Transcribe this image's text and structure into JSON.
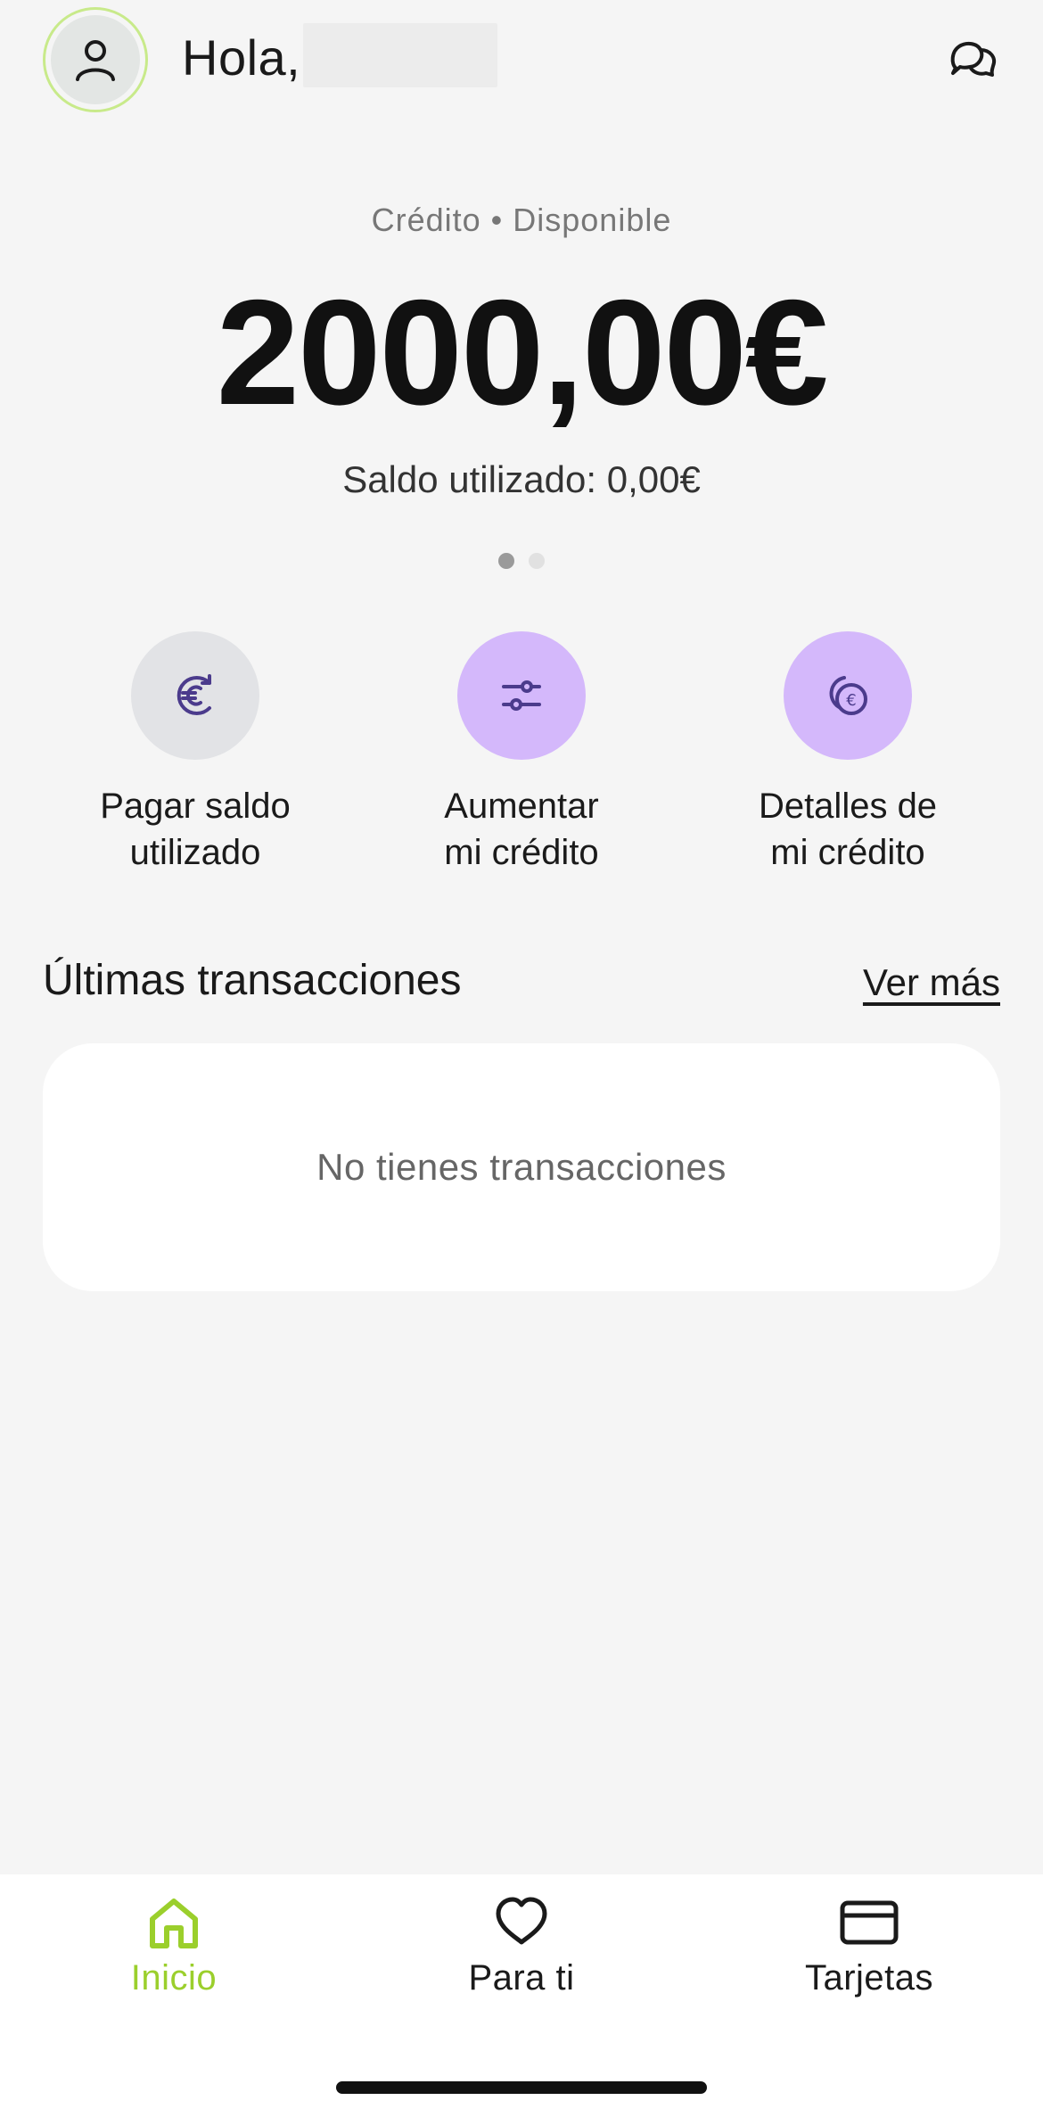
{
  "header": {
    "greeting": "Hola,",
    "avatar_icon": "user-icon",
    "chat_icon": "chat-bubbles-icon"
  },
  "balance": {
    "label": "Crédito • Disponible",
    "amount": "2000,00€",
    "used": "Saldo utilizado: 0,00€",
    "pages": 2,
    "active_page": 1
  },
  "actions": [
    {
      "label": "Pagar saldo\nutilizado",
      "icon": "euro-refresh-icon",
      "bg": "#e2e3e6"
    },
    {
      "label": "Aumentar\nmi crédito",
      "icon": "sliders-icon",
      "bg": "#d4b8fb"
    },
    {
      "label": "Detalles de\nmi crédito",
      "icon": "coins-euro-icon",
      "bg": "#d4b8fb"
    }
  ],
  "transactions": {
    "title": "Últimas transacciones",
    "more_label": "Ver más",
    "empty_text": "No tienes transacciones"
  },
  "nav": [
    {
      "label": "Inicio",
      "icon": "home-icon",
      "active": true
    },
    {
      "label": "Para ti",
      "icon": "heart-icon",
      "active": false
    },
    {
      "label": "Tarjetas",
      "icon": "card-icon",
      "active": false
    }
  ],
  "colors": {
    "accent": "#9bcf2c",
    "icon_purple": "#4b3b8c",
    "background": "#f5f5f5"
  }
}
